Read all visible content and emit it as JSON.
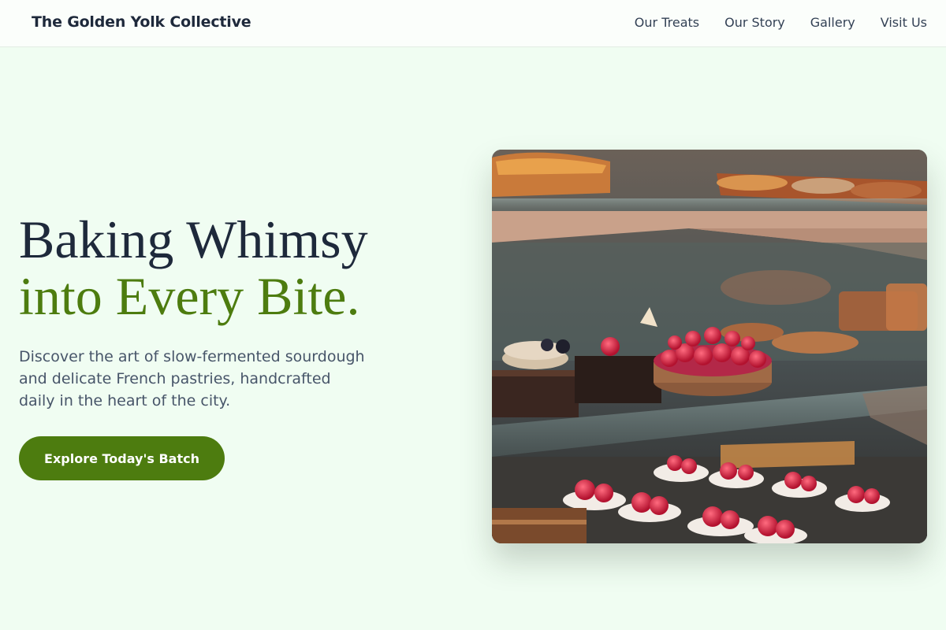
{
  "header": {
    "brand": "The Golden Yolk Collective",
    "nav": [
      "Our Treats",
      "Our Story",
      "Gallery",
      "Visit Us"
    ]
  },
  "hero": {
    "title_line1": "Baking Whimsy",
    "title_line2": "into Every Bite.",
    "subtitle": "Discover the art of slow-fermented sourdough and delicate French pastries, handcrafted daily in the heart of the city.",
    "cta_label": "Explore Today's Batch"
  },
  "colors": {
    "background": "#f0fdf2",
    "accent": "#4d7c0f",
    "heading": "#1e293b",
    "body_text": "#475569"
  }
}
